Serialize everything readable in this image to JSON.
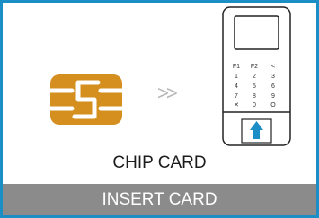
{
  "illustration": {
    "arrows_text": ">>",
    "keypad_rows": [
      [
        "F1",
        "F2",
        "<"
      ],
      [
        "1",
        "2",
        "3"
      ],
      [
        "4",
        "5",
        "6"
      ],
      [
        "7",
        "8",
        "9"
      ],
      [
        "✕",
        "0",
        "O"
      ]
    ]
  },
  "caption": "CHIP CARD",
  "footer": {
    "label": "INSERT CARD"
  },
  "colors": {
    "border": "#1b8ec6",
    "chip": "#d58f1f",
    "footer_bg": "#8b8b8b",
    "insert_arrow": "#1b8ec6"
  },
  "icons": [
    "chip-card-icon",
    "double-chevron-icon",
    "card-terminal-icon",
    "up-arrow-icon"
  ]
}
